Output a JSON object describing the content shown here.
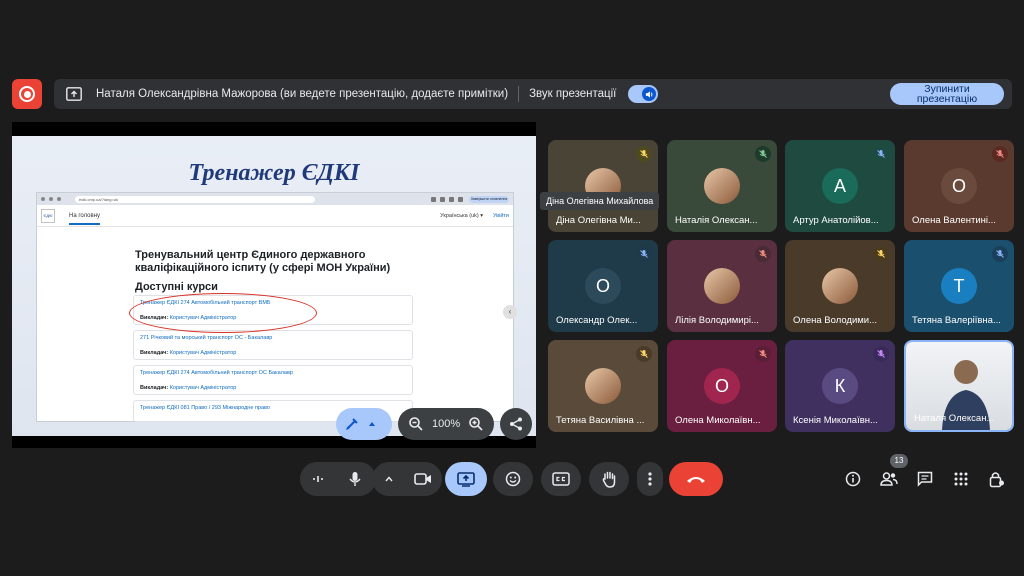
{
  "topbar": {
    "presenter_text": "Наталя Олександрівна Мажорова (ви ведете презентацію, додаєте примітки)",
    "sound_label": "Звук презентації",
    "stop_label": "Зупинити презентацію"
  },
  "slide": {
    "title": "Тренажер ЄДКІ",
    "browser_url": "edki.cmp.ua/?lang=uk",
    "browser_update": "Завершити оновлення",
    "site_logo": "ЄДКІ",
    "site_home": "На головну",
    "site_lang": "Українська (uk) ▾",
    "site_login": "Увійти",
    "heading": "Тренувальний центр Єдиного державного кваліфікаційного іспиту (у сфері МОН України)",
    "courses_heading": "Доступні курси",
    "teacher_label": "Викладач:",
    "courses": [
      {
        "name": "Тренажер ЄДКІ 274 Автомобільний транспорт ВМБ",
        "teacher": "Користувач Адміністратор"
      },
      {
        "name": "271 Річковий та морський транспорт ОС - Бакалавр",
        "teacher": "Користувач Адміністратор"
      },
      {
        "name": "Тренажер ЄДКІ 274 Автомобільний транспорт ОС Бакалавр",
        "teacher": "Користувач Адміністратор"
      },
      {
        "name": "Тренажер ЄДКІ 081 Право / 293 Міжнародне право",
        "teacher": ""
      }
    ],
    "zoom": "100%"
  },
  "tooltip": "Діна Олегівна Михайлова",
  "participants": [
    {
      "name": "Діна Олегівна Ми...",
      "initial": "",
      "bg": "#4a4436",
      "avatar_bg": "",
      "mute_bg": "#4d4a1f",
      "mute_color": "#fdd663"
    },
    {
      "name": "Наталія Олексан...",
      "initial": "",
      "bg": "#3a4a3a",
      "avatar_bg": "",
      "mute_bg": "#1e3a2a",
      "mute_color": "#81c995"
    },
    {
      "name": "Артур Анатолійов...",
      "initial": "А",
      "bg": "#1f4a40",
      "avatar_bg": "#1a6b5a",
      "mute_bg": "#1d4a42",
      "mute_color": "#8ab4f8"
    },
    {
      "name": "Олена Валентині...",
      "initial": "О",
      "bg": "#5a3a2e",
      "avatar_bg": "#6b4a3e",
      "mute_bg": "#5a2a22",
      "mute_color": "#f28b82"
    },
    {
      "name": "Олександр Олек...",
      "initial": "О",
      "bg": "#1f3a48",
      "avatar_bg": "#2c4a5a",
      "mute_bg": "#1e3a4a",
      "mute_color": "#8ab4f8"
    },
    {
      "name": "Лілія Володимирі...",
      "initial": "",
      "bg": "#5a3040",
      "avatar_bg": "",
      "mute_bg": "#4a2a34",
      "mute_color": "#f28b82"
    },
    {
      "name": "Олена Володими...",
      "initial": "",
      "bg": "#4a3a2a",
      "avatar_bg": "",
      "mute_bg": "#4a3a1f",
      "mute_color": "#fdd663"
    },
    {
      "name": "Тетяна Валеріївна...",
      "initial": "Т",
      "bg": "#1a4f6e",
      "avatar_bg": "#1a7fc0",
      "mute_bg": "#1a3f5a",
      "mute_color": "#8ab4f8"
    },
    {
      "name": "Тетяна Василівна ...",
      "initial": "",
      "bg": "#5a4a3a",
      "avatar_bg": "",
      "mute_bg": "#4a3a2a",
      "mute_color": "#fdd663"
    },
    {
      "name": "Олена Миколаївн...",
      "initial": "О",
      "bg": "#6a1f40",
      "avatar_bg": "#a0264f",
      "mute_bg": "#5a1f34",
      "mute_color": "#f28b82"
    },
    {
      "name": "Ксенія Миколаївн...",
      "initial": "К",
      "bg": "#3f3060",
      "avatar_bg": "#5a4a82",
      "mute_bg": "#3a2a5a",
      "mute_color": "#c58af9"
    },
    {
      "name": "Наталя Олексан...",
      "initial": "",
      "bg": "#2a2a2a",
      "avatar_bg": "",
      "mute_bg": "",
      "mute_color": ""
    }
  ],
  "people_count": "13",
  "icons": {
    "record": "record-icon",
    "present": "present-to-all-icon",
    "sound": "volume-icon",
    "pen": "pen-icon",
    "zoom_out": "zoom-out-icon",
    "zoom_in": "zoom-in-icon",
    "share": "share-icon"
  }
}
